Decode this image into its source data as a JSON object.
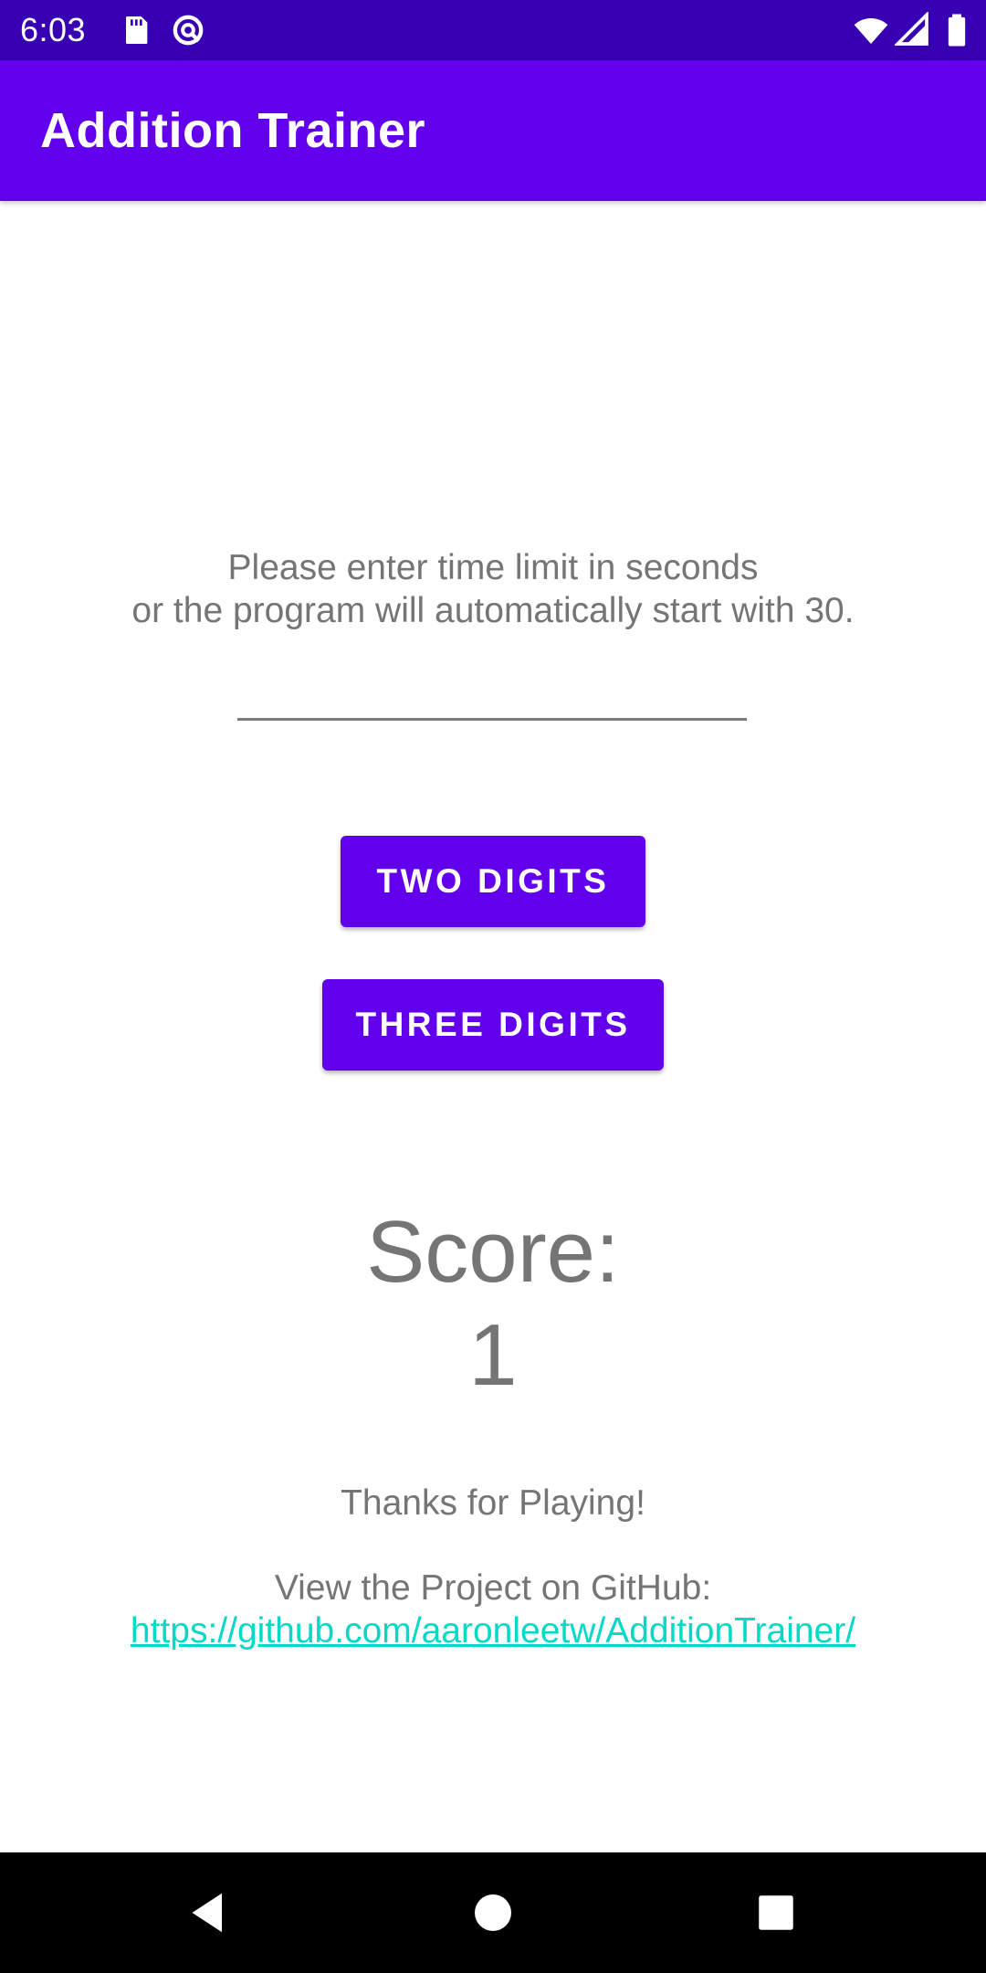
{
  "status_bar": {
    "time": "6:03",
    "icons": [
      "sd-card-icon",
      "data-saver-icon",
      "wifi-icon",
      "signal-icon",
      "battery-icon"
    ]
  },
  "app_bar": {
    "title": "Addition Trainer"
  },
  "main": {
    "prompt_line1": "Please enter time limit in seconds",
    "prompt_line2": "or the program will automatically start with 30.",
    "time_input": {
      "value": "",
      "placeholder": ""
    },
    "two_digits_label": "TWO DIGITS",
    "three_digits_label": "THREE DIGITS",
    "score_label": "Score:",
    "score_value": "1",
    "thanks_text": "Thanks for Playing!",
    "github_text": "View the Project on GitHub:",
    "github_link": "https://github.com/aaronleetw/AdditionTrainer/"
  },
  "nav_bar": {
    "buttons": [
      "back-icon",
      "home-icon",
      "recents-icon"
    ]
  },
  "colors": {
    "status_bar": "#3700b3",
    "primary": "#6200ee",
    "text_gray": "#757575",
    "link": "#03dac5",
    "nav_bar": "#000000"
  }
}
